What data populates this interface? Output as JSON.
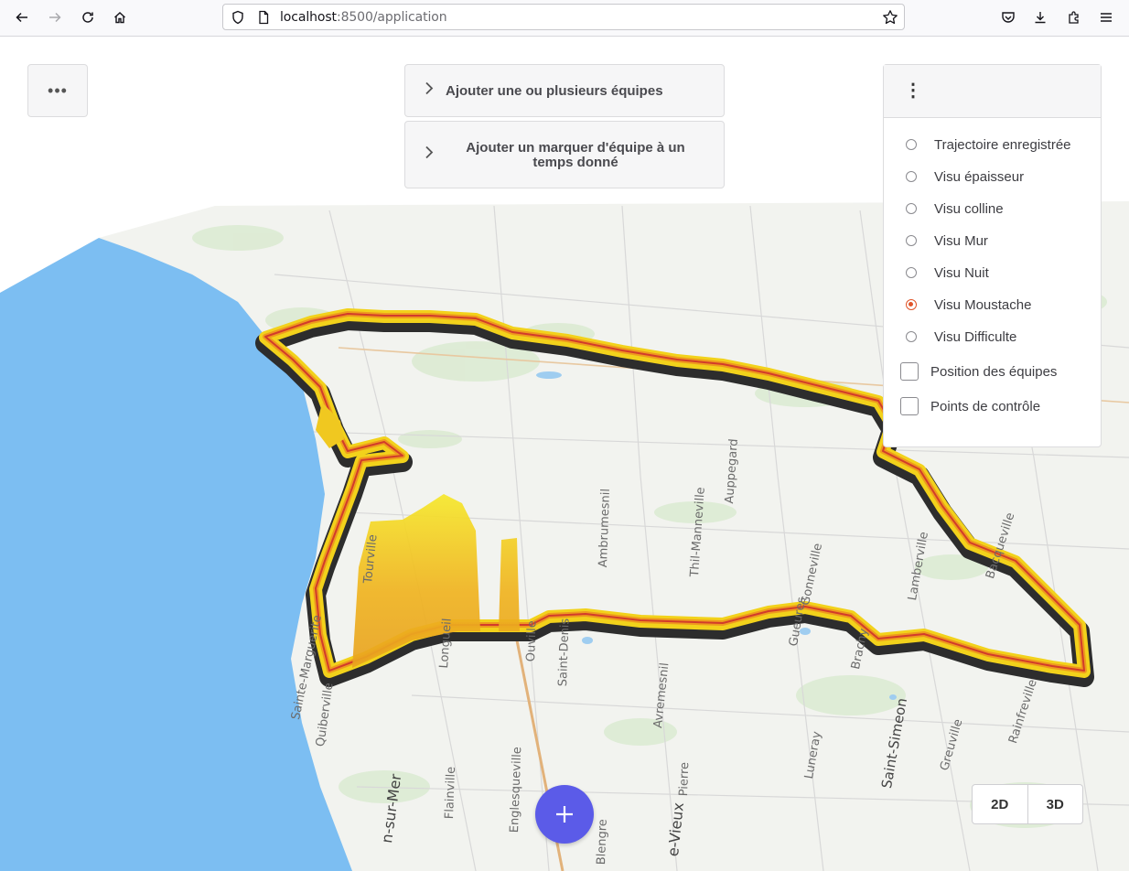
{
  "browser": {
    "url_host": "localhost",
    "url_rest": ":8500/application"
  },
  "panels": {
    "add_teams": "Ajouter une ou plusieurs équipes",
    "add_marker": "Ajouter un marquer d'équipe à un temps donné"
  },
  "layers": {
    "options": [
      {
        "label": "Trajectoire enregistrée",
        "selected": false
      },
      {
        "label": "Visu épaisseur",
        "selected": false
      },
      {
        "label": "Visu colline",
        "selected": false
      },
      {
        "label": "Visu Mur",
        "selected": false
      },
      {
        "label": "Visu Nuit",
        "selected": false
      },
      {
        "label": "Visu Moustache",
        "selected": true
      },
      {
        "label": "Visu Difficulte",
        "selected": false
      }
    ],
    "checkboxes": [
      {
        "label": "Position des équipes",
        "checked": false
      },
      {
        "label": "Points de contrôle",
        "checked": false
      }
    ]
  },
  "view_toggle": {
    "btn_2d": "2D",
    "btn_3d": "3D"
  },
  "map_labels": {
    "l1": "Sainte-Marguerite",
    "l2": "Quiberville",
    "l3": "Saint-Denis",
    "l4": "Avremesnil",
    "l5": "Luneray",
    "l6": "Gueures",
    "l7": "Brachy",
    "l8": "Greuville",
    "l9": "Bacqueville",
    "l10": "Lamberville",
    "l11": "Rainfreville",
    "l12": "Ouville",
    "l13": "Longueil",
    "l14": "Ambrumesnil",
    "l15": "Tourville",
    "l16": "Thil-Manneville",
    "l17": "Auppegard",
    "l18": "Flainville",
    "l19": "Englesqueville",
    "l20": "Blengre",
    "l21": "Pierre",
    "l22": "n-sur-Mer",
    "l23": "Saint-Simeon",
    "l24": "e-Vieux",
    "l25": "Gonneville"
  },
  "colors": {
    "sea": "#7cbef2",
    "accent_radio": "#e0552a",
    "fab": "#5b5be8",
    "route_yellow": "#f2d21b"
  }
}
